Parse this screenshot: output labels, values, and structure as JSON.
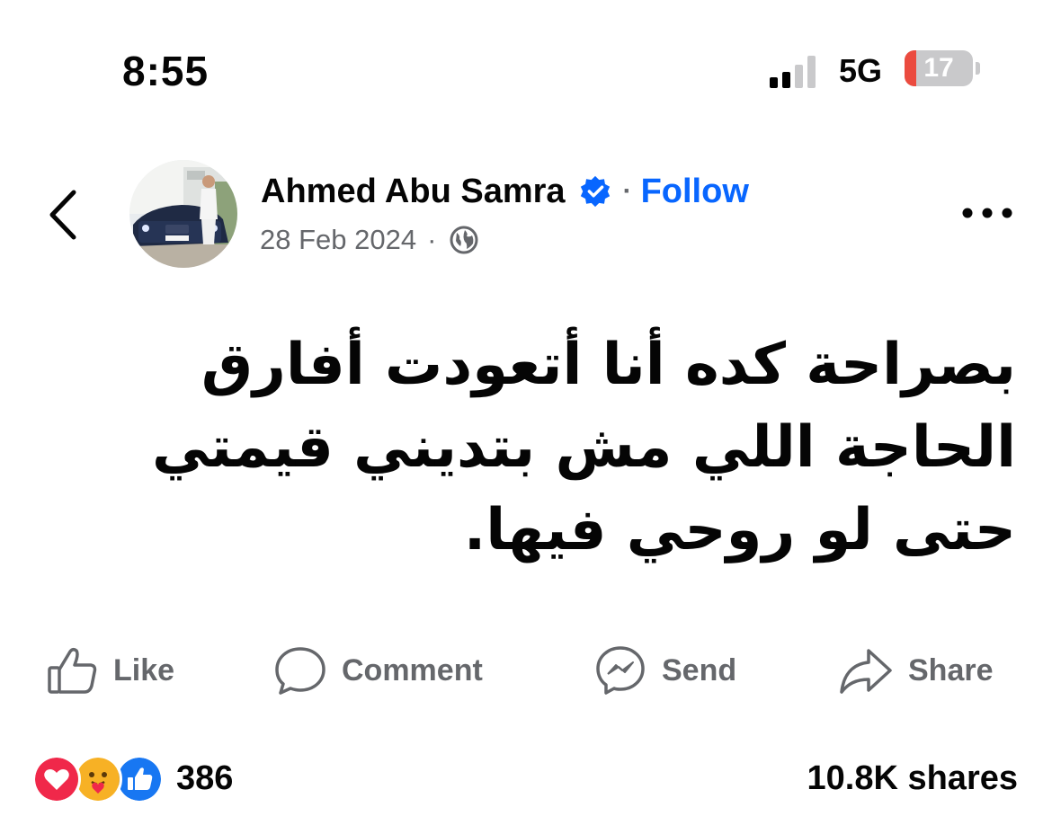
{
  "status_bar": {
    "time": "8:55",
    "network": "5G",
    "battery_level": "17",
    "battery_percent": 17,
    "signal_bars_active": 2,
    "signal_bars_total": 4
  },
  "post": {
    "author": "Ahmed Abu Samra",
    "separator": "·",
    "follow_label": "Follow",
    "date": "28 Feb 2024",
    "meta_separator": "·",
    "privacy_icon": "globe-icon",
    "text": "بصراحة كده أنا أتعودت أفارق الحاجة اللي مش بتديني قيمتي حتى لو روحي فيها."
  },
  "actions": {
    "like": "Like",
    "comment": "Comment",
    "send": "Send",
    "share": "Share"
  },
  "stats": {
    "reaction_icons": [
      "love-reaction-icon",
      "care-reaction-icon",
      "like-reaction-icon"
    ],
    "reaction_count": "386",
    "shares": "10.8K shares"
  },
  "colors": {
    "accent": "#0866ff",
    "secondary_text": "#65676b",
    "battery_low": "#eb4b3f"
  }
}
